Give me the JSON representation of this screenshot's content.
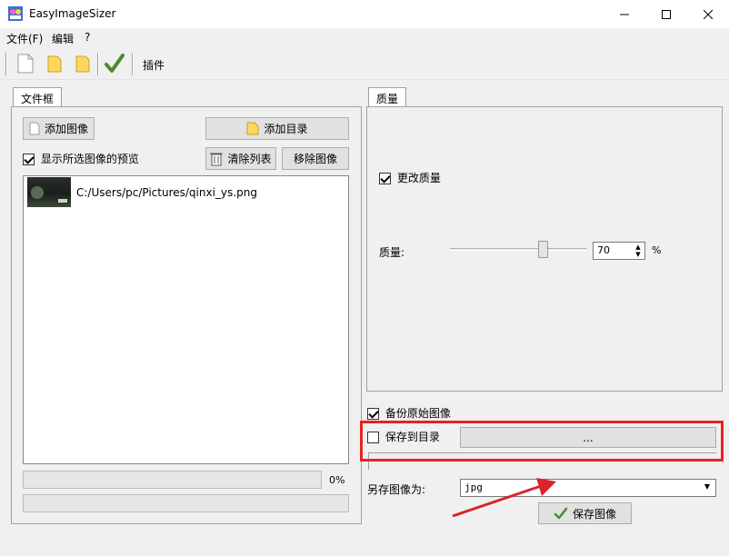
{
  "window": {
    "title": "EasyImageSizer",
    "minimize": "—",
    "maximize": "☐",
    "close": "✕"
  },
  "menu": {
    "file": "文件(F)",
    "edit": "编辑",
    "help": "?"
  },
  "toolbar": {
    "plugin_label": "插件",
    "icons": [
      "new-file-icon",
      "open-folder-icon",
      "folder-icon",
      "checkmark-icon"
    ]
  },
  "files_panel": {
    "tab_label": "文件框",
    "add_image": "添加图像",
    "add_directory": "添加目录",
    "show_preview_label": "显示所选图像的预览",
    "show_preview_checked": true,
    "clear_list": "清除列表",
    "remove_image": "移除图像",
    "files": [
      {
        "path": "C:/Users/pc/Pictures/qinxi_ys.png"
      }
    ],
    "progress_percent_label": "0%",
    "progress": 0
  },
  "quality_panel": {
    "tab_label": "质量",
    "change_quality_label": "更改质量",
    "change_quality_checked": true,
    "quality_label": "质量:",
    "quality_value": "70",
    "quality_level": 70,
    "percent_sign": "%"
  },
  "options": {
    "backup_label": "备份原始图像",
    "backup_checked": true,
    "save_to_dir_label": "保存到目录",
    "save_to_dir_checked": false,
    "browse_label": "...",
    "save_as_label": "另存图像为:",
    "format_value": "jpg",
    "save_button": "保存图像"
  },
  "colors": {
    "highlight_box": "#e8231f",
    "arrow": "#d9262a",
    "check_green": "#4a8a2a"
  }
}
